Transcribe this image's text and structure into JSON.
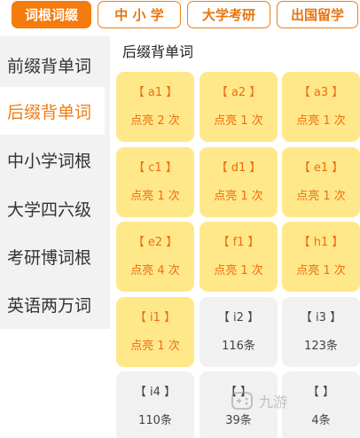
{
  "top_tabs": [
    {
      "label": "词根词缀",
      "active": true
    },
    {
      "label": "中 小 学",
      "active": false
    },
    {
      "label": "大学考研",
      "active": false
    },
    {
      "label": "出国留学",
      "active": false
    }
  ],
  "sidebar": {
    "items": [
      {
        "label": "前缀背单词",
        "active": false
      },
      {
        "label": "后缀背单词",
        "active": true
      },
      {
        "label": "中小学词根",
        "active": false
      },
      {
        "label": "大学四六级",
        "active": false
      },
      {
        "label": "考研博词根",
        "active": false
      },
      {
        "label": "英语两万词",
        "active": false
      }
    ]
  },
  "section_title": "后缀背单词",
  "cards": [
    {
      "name": "【 a1 】",
      "sub": "点亮 2 次",
      "lit": true
    },
    {
      "name": "【 a2 】",
      "sub": "点亮 1 次",
      "lit": true
    },
    {
      "name": "【 a3 】",
      "sub": "点亮 1 次",
      "lit": true
    },
    {
      "name": "【 c1 】",
      "sub": "点亮 1 次",
      "lit": true
    },
    {
      "name": "【 d1 】",
      "sub": "点亮 1 次",
      "lit": true
    },
    {
      "name": "【 e1 】",
      "sub": "点亮 1 次",
      "lit": true
    },
    {
      "name": "【 e2 】",
      "sub": "点亮 4 次",
      "lit": true
    },
    {
      "name": "【 f1 】",
      "sub": "点亮 1 次",
      "lit": true
    },
    {
      "name": "【 h1 】",
      "sub": "点亮 1 次",
      "lit": true
    },
    {
      "name": "【 i1 】",
      "sub": "点亮 1 次",
      "lit": true
    },
    {
      "name": "【 i2 】",
      "sub": "116条",
      "lit": false
    },
    {
      "name": "【 i3 】",
      "sub": "123条",
      "lit": false
    },
    {
      "name": "【 i4 】",
      "sub": "110条",
      "lit": false
    },
    {
      "name": "【  】",
      "sub": "39条",
      "lit": false
    },
    {
      "name": "【  】",
      "sub": "4条",
      "lit": false
    }
  ],
  "watermark": {
    "text": "九游",
    "icon": "gamepad-icon"
  },
  "colors": {
    "accent": "#f57b0c",
    "card_lit": "#ffe88a",
    "card_dim": "#f1f1f1",
    "sidebar_bg": "#f2f2f2"
  }
}
